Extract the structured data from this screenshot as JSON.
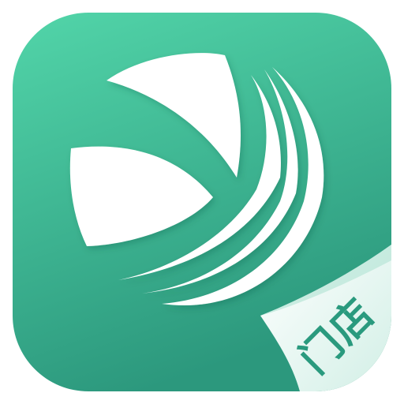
{
  "icon": {
    "name": "store-app-icon",
    "badge_label": "门店",
    "colors": {
      "background_top": "#4fd2a6",
      "background_bottom": "#2e9c80",
      "mark": "#ffffff",
      "page_curl": "#dff5ee",
      "badge_text": "#2a9a7e"
    }
  }
}
